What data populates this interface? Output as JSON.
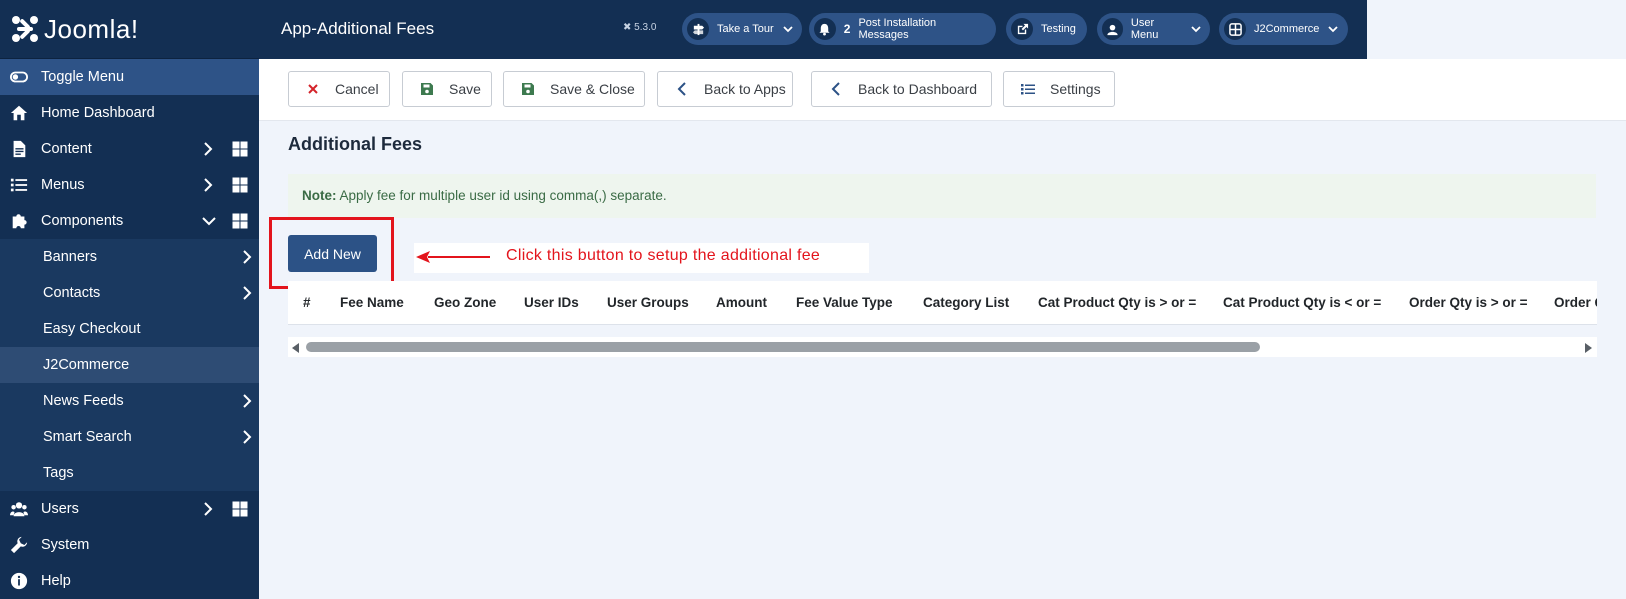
{
  "app": {
    "logo_text": "Joomla!",
    "page_title": "App-Additional Fees",
    "version": "5.3.0"
  },
  "header": {
    "pills": [
      {
        "label": "Take a Tour",
        "icon": "signpost-icon"
      },
      {
        "label": "Post Installation Messages",
        "icon": "bell-icon",
        "count": "2"
      },
      {
        "label": "Testing",
        "icon": "external-link-icon"
      },
      {
        "label": "User Menu",
        "icon": "user-icon"
      },
      {
        "label": "J2Commerce",
        "icon": "apps-icon"
      }
    ]
  },
  "sidebar": {
    "items": [
      {
        "label": "Toggle Menu",
        "icon": "toggle-icon"
      },
      {
        "label": "Home Dashboard",
        "icon": "home-icon"
      },
      {
        "label": "Content",
        "icon": "file-icon"
      },
      {
        "label": "Menus",
        "icon": "list-icon"
      },
      {
        "label": "Components",
        "icon": "puzzle-icon"
      },
      {
        "label": "Banners"
      },
      {
        "label": "Contacts"
      },
      {
        "label": "Easy Checkout"
      },
      {
        "label": "J2Commerce"
      },
      {
        "label": "News Feeds"
      },
      {
        "label": "Smart Search"
      },
      {
        "label": "Tags"
      },
      {
        "label": "Users",
        "icon": "users-icon"
      },
      {
        "label": "System",
        "icon": "wrench-icon"
      },
      {
        "label": "Help",
        "icon": "info-icon"
      }
    ]
  },
  "toolbar": {
    "cancel": "Cancel",
    "save": "Save",
    "save_close": "Save & Close",
    "back_apps": "Back to Apps",
    "back_dashboard": "Back to Dashboard",
    "settings": "Settings"
  },
  "main": {
    "title": "Additional Fees",
    "note_label": "Note:",
    "note_text": "Apply fee for multiple user id using comma(,) separate.",
    "add_new": "Add New",
    "annotation": "Click this button to setup the additional fee",
    "columns": [
      "#",
      "Fee Name",
      "Geo Zone",
      "User IDs",
      "User Groups",
      "Amount",
      "Fee Value Type",
      "Category List",
      "Cat Product Qty is > or =",
      "Cat Product Qty is < or =",
      "Order Qty is > or =",
      "Order Qty is < or ="
    ]
  },
  "colors": {
    "sidebar_bg": "#132f53",
    "primary": "#2c5286",
    "annotation": "#e3141c",
    "note_bg": "#eef5ee"
  }
}
